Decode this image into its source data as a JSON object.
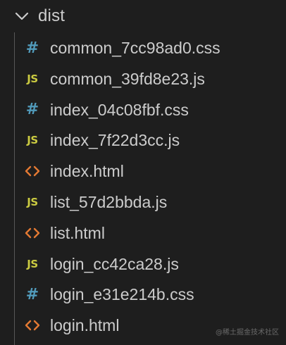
{
  "explorer": {
    "folder": {
      "name": "dist",
      "expanded": true,
      "chevron_icon": "chevron-down-icon"
    },
    "files": [
      {
        "name": "common_7cc98ad0.css",
        "type": "css",
        "icon": "css-file-icon",
        "glyph": "#",
        "color": "#519aba"
      },
      {
        "name": "common_39fd8e23.js",
        "type": "js",
        "icon": "js-file-icon",
        "glyph": "JS",
        "color": "#cbcb41"
      },
      {
        "name": "index_04c08fbf.css",
        "type": "css",
        "icon": "css-file-icon",
        "glyph": "#",
        "color": "#519aba"
      },
      {
        "name": "index_7f22d3cc.js",
        "type": "js",
        "icon": "js-file-icon",
        "glyph": "JS",
        "color": "#cbcb41"
      },
      {
        "name": "index.html",
        "type": "html",
        "icon": "html-file-icon",
        "glyph": "<>",
        "color": "#e37933"
      },
      {
        "name": "list_57d2bbda.js",
        "type": "js",
        "icon": "js-file-icon",
        "glyph": "JS",
        "color": "#cbcb41"
      },
      {
        "name": "list.html",
        "type": "html",
        "icon": "html-file-icon",
        "glyph": "<>",
        "color": "#e37933"
      },
      {
        "name": "login_cc42ca28.js",
        "type": "js",
        "icon": "js-file-icon",
        "glyph": "JS",
        "color": "#cbcb41"
      },
      {
        "name": "login_e31e214b.css",
        "type": "css",
        "icon": "css-file-icon",
        "glyph": "#",
        "color": "#519aba"
      },
      {
        "name": "login.html",
        "type": "html",
        "icon": "html-file-icon",
        "glyph": "<>",
        "color": "#e37933"
      }
    ]
  },
  "watermark": "@稀土掘金技术社区",
  "colors": {
    "background": "#1e1e1e",
    "text": "#cccccc",
    "css": "#519aba",
    "js": "#cbcb41",
    "html": "#e37933",
    "guide": "#585858"
  }
}
